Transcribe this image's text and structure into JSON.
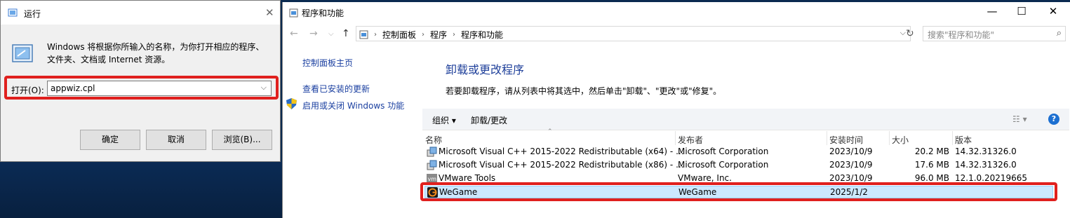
{
  "run_dialog": {
    "title": "运行",
    "description": "Windows 将根据你所输入的名称，为你打开相应的程序、文件夹、文档或 Internet 资源。",
    "open_label": "打开(O):",
    "input_value": "appwiz.cpl",
    "ok_label": "确定",
    "cancel_label": "取消",
    "browse_label": "浏览(B)..."
  },
  "control_panel": {
    "title": "程序和功能",
    "breadcrumbs": [
      "控制面板",
      "程序",
      "程序和功能"
    ],
    "search_placeholder": "搜索\"程序和功能\"",
    "sidebar": {
      "home": "控制面板主页",
      "updates": "查看已安装的更新",
      "features": "启用或关闭 Windows 功能"
    },
    "heading": "卸载或更改程序",
    "subtitle": "若要卸载程序，请从列表中将其选中，然后单击\"卸载\"、\"更改\"或\"修复\"。",
    "toolbar": {
      "organize": "组织",
      "uninstall_change": "卸载/更改"
    },
    "columns": {
      "name": "名称",
      "publisher": "发布者",
      "installed": "安装时间",
      "size": "大小",
      "version": "版本"
    },
    "programs": [
      {
        "name": "Microsoft Visual C++ 2015-2022 Redistributable (x64) - ...",
        "publisher": "Microsoft Corporation",
        "installed": "2023/10/9",
        "size": "20.2 MB",
        "version": "14.32.31326.0"
      },
      {
        "name": "Microsoft Visual C++ 2015-2022 Redistributable (x86) - ...",
        "publisher": "Microsoft Corporation",
        "installed": "2023/10/9",
        "size": "17.6 MB",
        "version": "14.32.31326.0"
      },
      {
        "name": "VMware Tools",
        "publisher": "VMware, Inc.",
        "installed": "2023/10/9",
        "size": "96.0 MB",
        "version": "12.1.0.20219665"
      },
      {
        "name": "WeGame",
        "publisher": "WeGame",
        "installed": "2025/1/2",
        "size": "",
        "version": ""
      }
    ]
  },
  "colors": {
    "highlight": "#e0201e",
    "link": "#1a3fa0",
    "heading": "#1e3f9a",
    "selection": "#cce8ff"
  }
}
